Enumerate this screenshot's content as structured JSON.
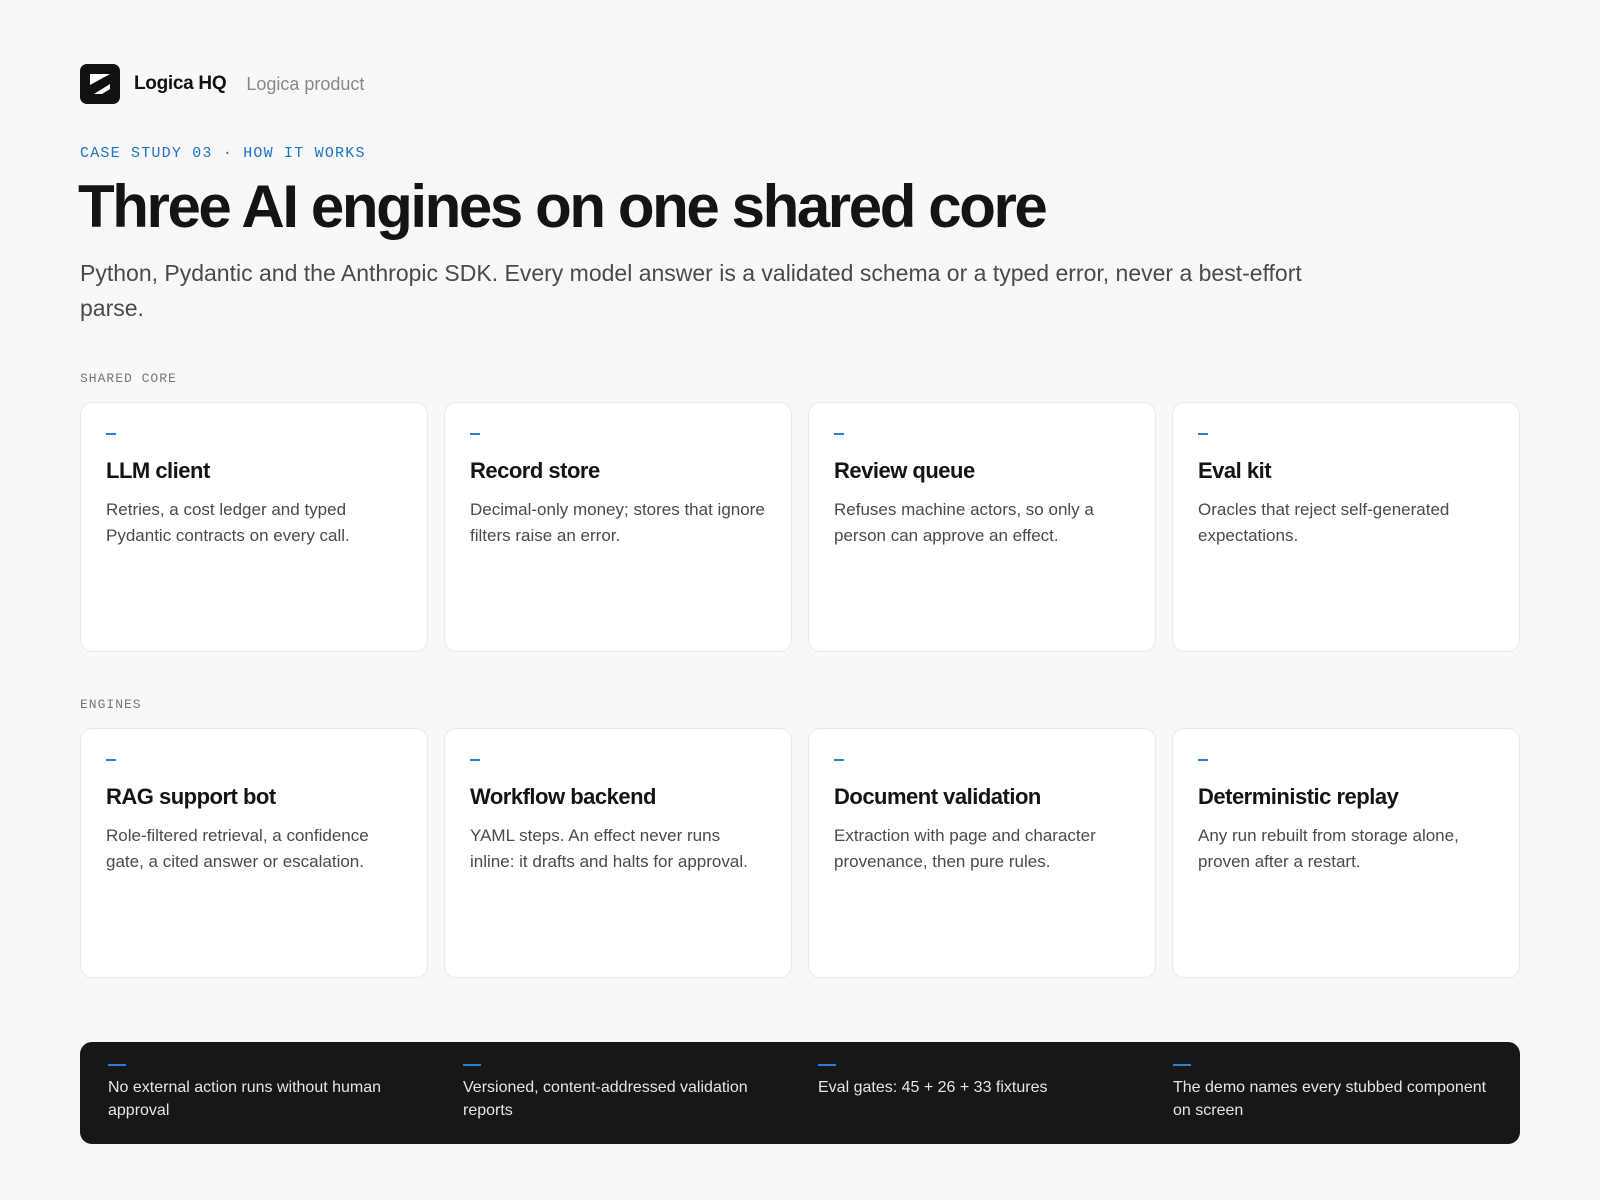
{
  "header": {
    "brand_name": "Logica HQ",
    "brand_sub": "Logica product",
    "logo_icon": "logica-logo"
  },
  "hero": {
    "eyebrow": "CASE STUDY 03 · HOW IT WORKS",
    "title": "Three AI engines on one shared core",
    "lede": "Python, Pydantic and the Anthropic SDK. Every model answer is a validated schema or a typed error, never a best-effort parse."
  },
  "shared_core": {
    "label": "SHARED CORE",
    "cards": [
      {
        "title": "LLM client",
        "desc": "Retries, a cost ledger and typed Pydantic contracts on every call."
      },
      {
        "title": "Record store",
        "desc": "Decimal-only money; stores that ignore filters raise an error."
      },
      {
        "title": "Review queue",
        "desc": "Refuses machine actors, so only a person can approve an effect."
      },
      {
        "title": "Eval kit",
        "desc": "Oracles that reject self-generated expectations."
      }
    ]
  },
  "engines": {
    "label": "ENGINES",
    "cards": [
      {
        "title": "RAG support bot",
        "desc": "Role-filtered retrieval, a confidence gate, a cited answer or escalation."
      },
      {
        "title": "Workflow backend",
        "desc": "YAML steps. An effect never runs inline: it drafts and halts for approval."
      },
      {
        "title": "Document validation",
        "desc": "Extraction with page and character provenance, then pure rules."
      },
      {
        "title": "Deterministic replay",
        "desc": "Any run rebuilt from storage alone, proven after a restart."
      }
    ]
  },
  "facts": [
    "No external action runs without human approval",
    "Versioned, content-addressed validation reports",
    "Eval gates: 45 + 26 + 33 fixtures",
    "The demo names every stubbed component on screen"
  ],
  "colors": {
    "accent": "#2b7fd6",
    "eyebrow": "#1a73c8",
    "dark_bar": "#171717",
    "background": "#f8f8f8"
  }
}
